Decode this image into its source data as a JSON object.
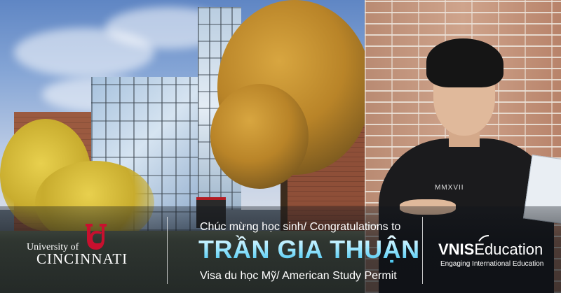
{
  "university": {
    "line1": "University of",
    "line2": "CINCINNATI",
    "logo_color": "#c8102e"
  },
  "message": {
    "congrats": "Chúc mừng học sinh/ Congratulations to",
    "student_name": "TRẦN GIA THUẬN",
    "visa": "Visa du học Mỹ/ American Study Permit"
  },
  "brand": {
    "name_bold": "VNIS",
    "name_rest": "Education",
    "tagline": "Engaging International Education"
  },
  "shirt_print": "MMXVII",
  "colors": {
    "name_gradient_top": "#eafaff",
    "name_gradient_bottom": "#3fc2ee"
  }
}
